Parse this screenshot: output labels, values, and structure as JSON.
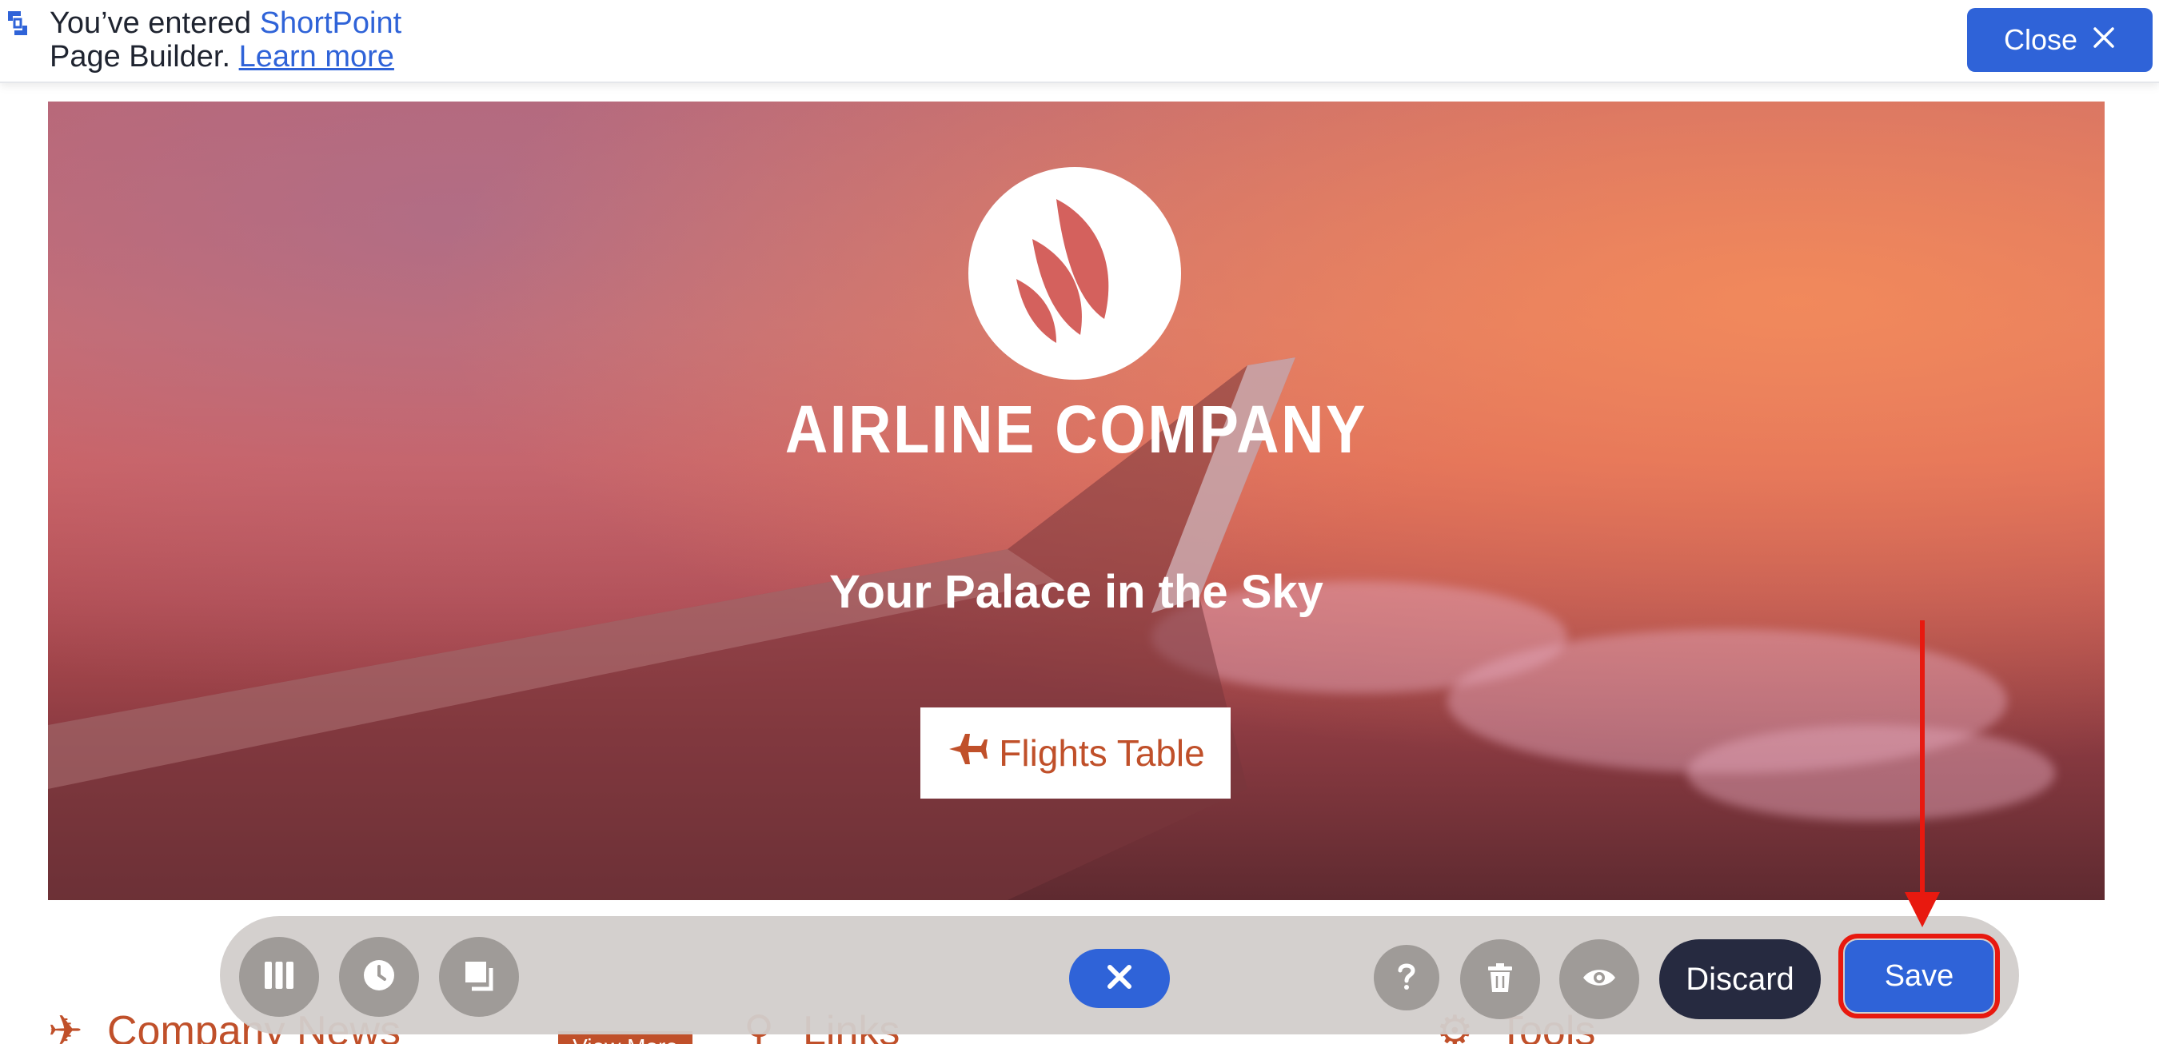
{
  "notice": {
    "prefix": "You’ve entered ",
    "brand": "ShortPoint",
    "middle": " Page Builder. ",
    "link": "Learn more"
  },
  "close_button": {
    "label": "Close"
  },
  "hero": {
    "company": "AIRLINE COMPANY",
    "tagline": "Your Palace in the Sky",
    "button_label": "Flights Table"
  },
  "below": {
    "col1_heading": "Company News",
    "view_more": "View More",
    "col2_heading": "Links",
    "col3_heading": "Tools"
  },
  "toolbar": {
    "discard_label": "Discard",
    "save_label": "Save"
  },
  "colors": {
    "brand_blue": "#2f63d8",
    "accent_orange": "#c0502a",
    "annotation_red": "#e8190f",
    "discard_dark": "#262a40"
  },
  "icons": [
    "shortpoint-logo-icon",
    "close-x-icon",
    "airline-logo-icon",
    "plane-icon",
    "columns-icon",
    "clock-icon",
    "layers-icon",
    "x-icon",
    "help-icon",
    "trash-icon",
    "eye-icon"
  ]
}
